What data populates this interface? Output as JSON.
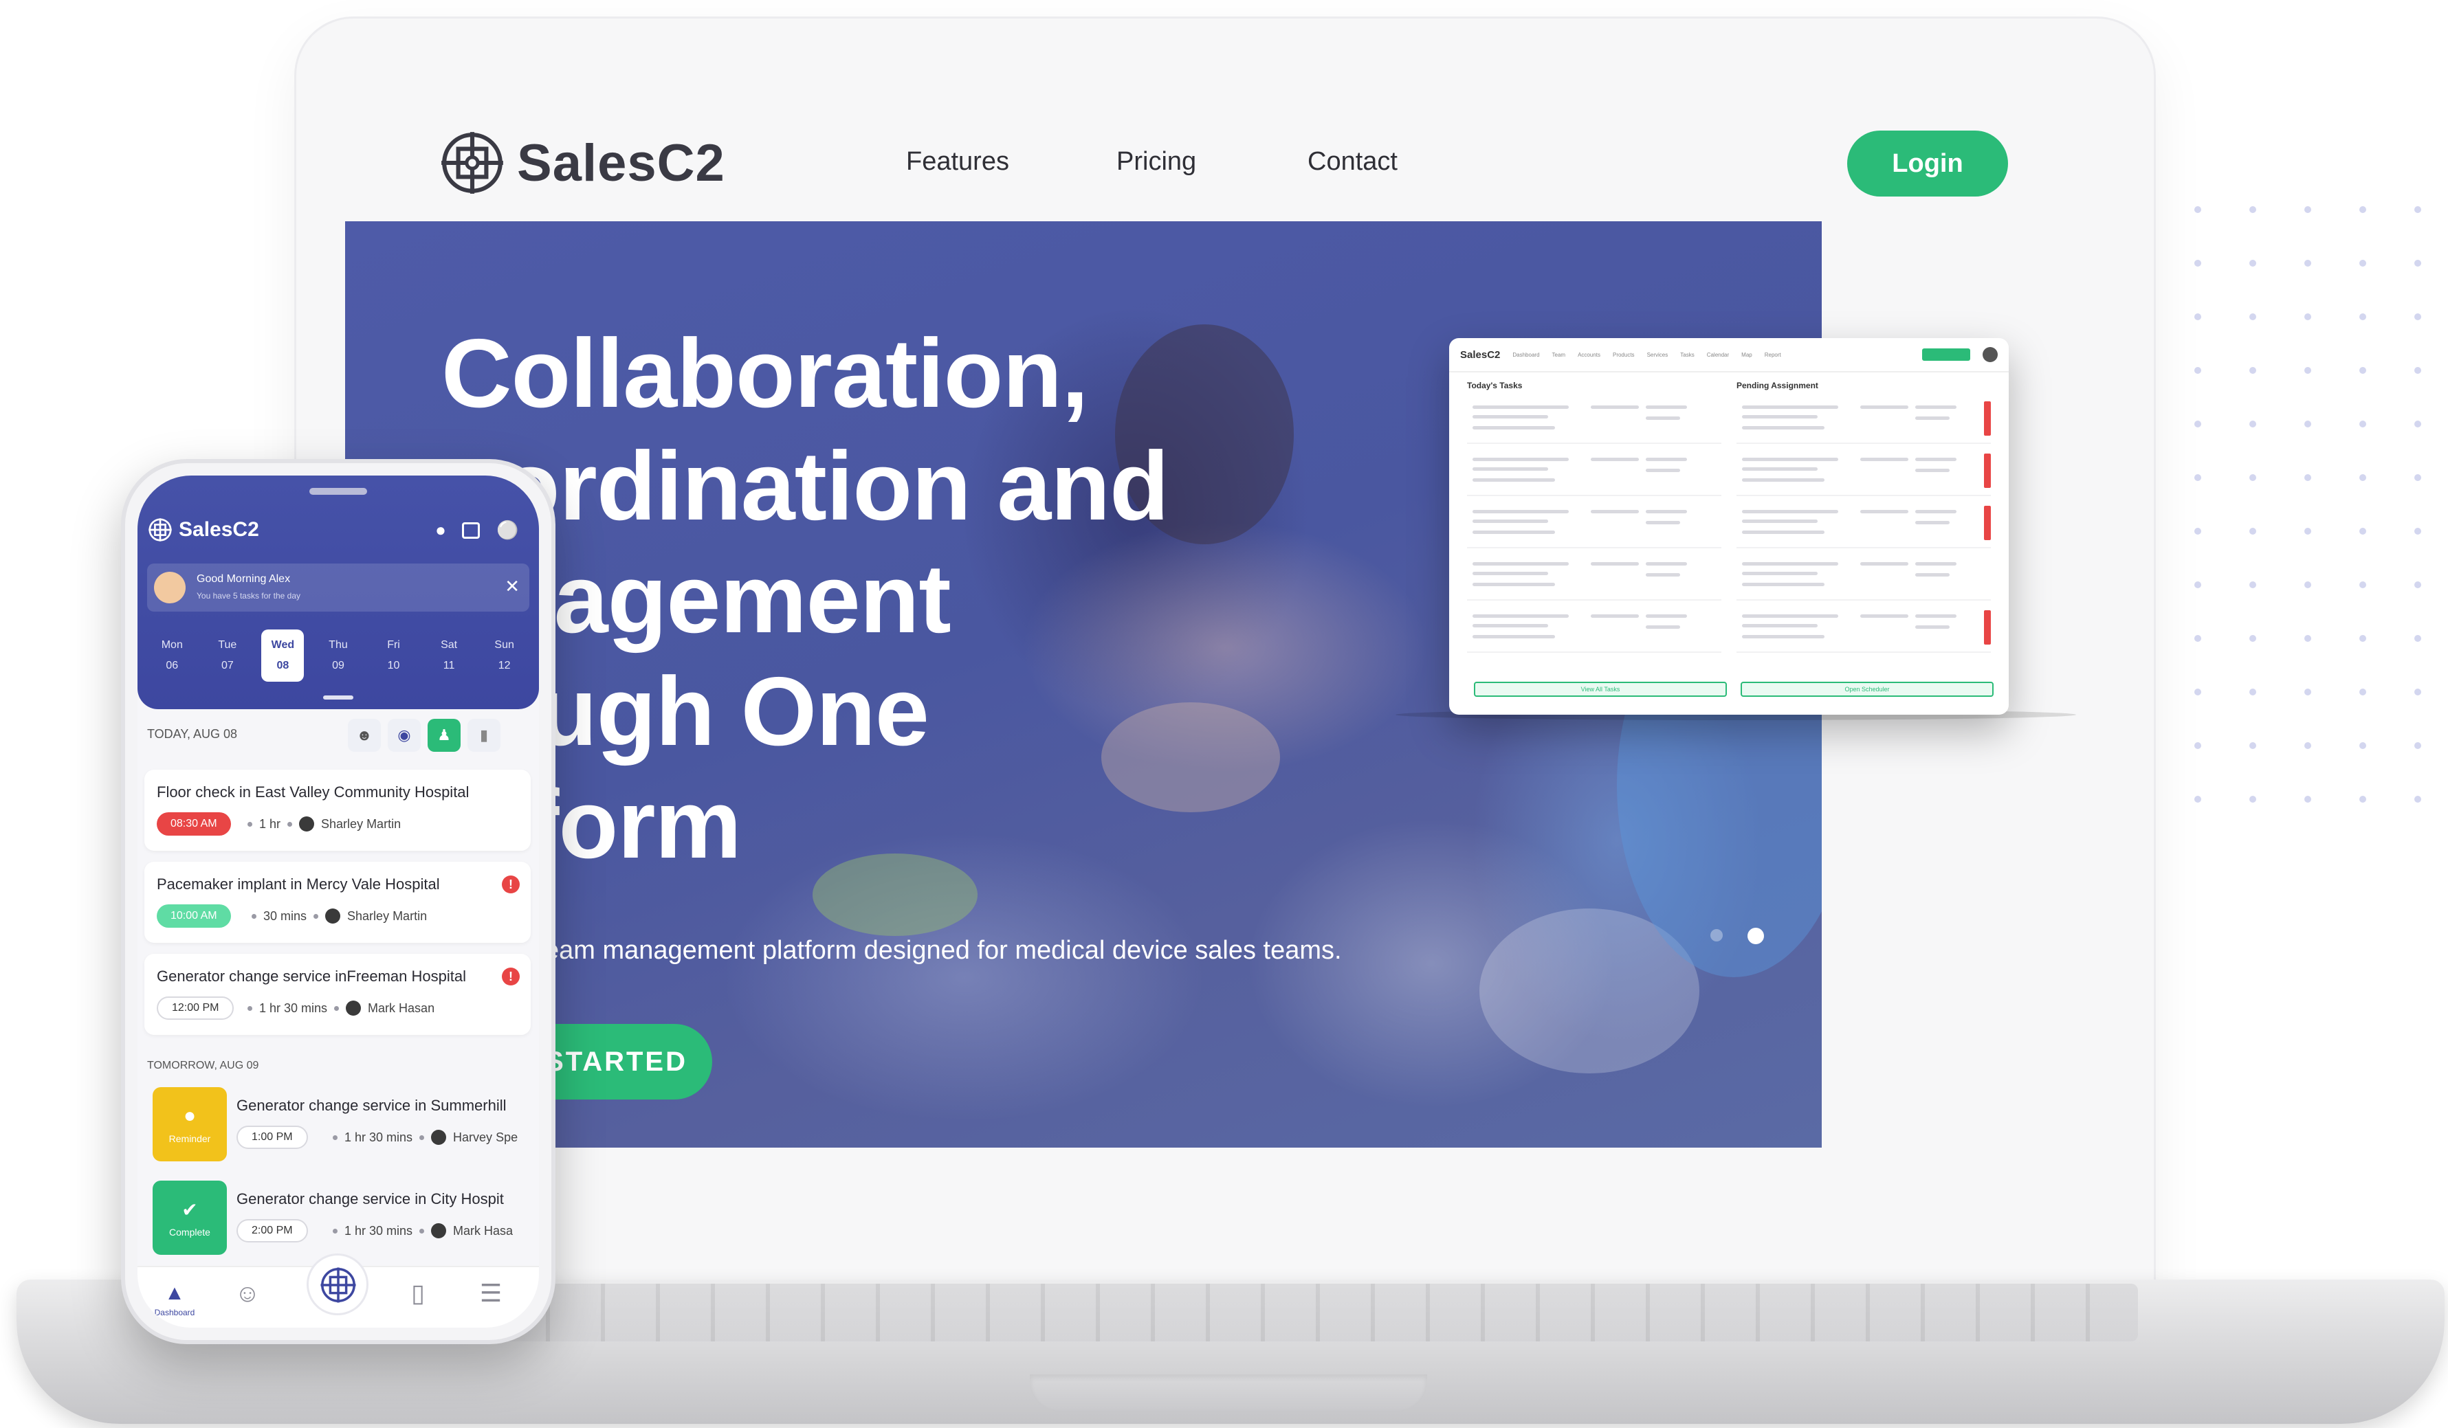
{
  "site": {
    "brand": "SalesC2",
    "nav": [
      "Features",
      "Pricing",
      "Contact"
    ],
    "login_label": "Login",
    "hero": {
      "title_lines": [
        "Collaboration,",
        "oordination and",
        "anagement",
        "rough One",
        "atform"
      ],
      "subtitle": "eam management platform designed for medical device sales teams.",
      "cta_label": "T STARTED"
    }
  },
  "dashboard_preview": {
    "brand": "SalesC2",
    "tabs": [
      "Dashboard",
      "Team",
      "Accounts",
      "Products",
      "Services",
      "Tasks",
      "Calendar",
      "Map",
      "Report"
    ],
    "todays_tasks_title": "Today's Tasks",
    "pending_title": "Pending Assignment",
    "view_all_label": "View All Tasks",
    "open_scheduler_label": "Open Scheduler"
  },
  "phone": {
    "brand": "SalesC2",
    "greeting": {
      "title": "Good Morning Alex",
      "subtitle": "You have 5 tasks for the day"
    },
    "days": [
      {
        "name": "Mon",
        "num": "06"
      },
      {
        "name": "Tue",
        "num": "07"
      },
      {
        "name": "Wed",
        "num": "08"
      },
      {
        "name": "Thu",
        "num": "09"
      },
      {
        "name": "Fri",
        "num": "10"
      },
      {
        "name": "Sat",
        "num": "11"
      },
      {
        "name": "Sun",
        "num": "12"
      }
    ],
    "today_label": "TODAY, AUG 08",
    "tomorrow_label": "TOMORROW, AUG 09",
    "tasks_today": [
      {
        "title": "Floor check in East Valley Community Hospital",
        "time": "08:30 AM",
        "duration": "1 hr",
        "person": "Sharley Martin"
      },
      {
        "title": "Pacemaker implant in Mercy Vale Hospital",
        "time": "10:00 AM",
        "duration": "30 mins",
        "person": "Sharley Martin"
      },
      {
        "title": "Generator change service inFreeman Hospital",
        "time": "12:00 PM",
        "duration": "1 hr 30 mins",
        "person": "Mark Hasan"
      }
    ],
    "tasks_tomorrow": [
      {
        "tile": "Reminder",
        "title": "Generator change service in Summerhill",
        "time": "1:00 PM",
        "duration": "1 hr 30 mins",
        "person": "Harvey Spe"
      },
      {
        "tile": "Complete",
        "title": "Generator change service in City Hospit",
        "time": "2:00 PM",
        "duration": "1 hr 30 mins",
        "person": "Mark Hasa"
      }
    ],
    "tabbar_label": "Dashboard"
  },
  "colors": {
    "brand_green": "#2bbb78",
    "brand_indigo": "#3d47a0",
    "alert_red": "#e84545",
    "reminder_yellow": "#f2c21b"
  }
}
